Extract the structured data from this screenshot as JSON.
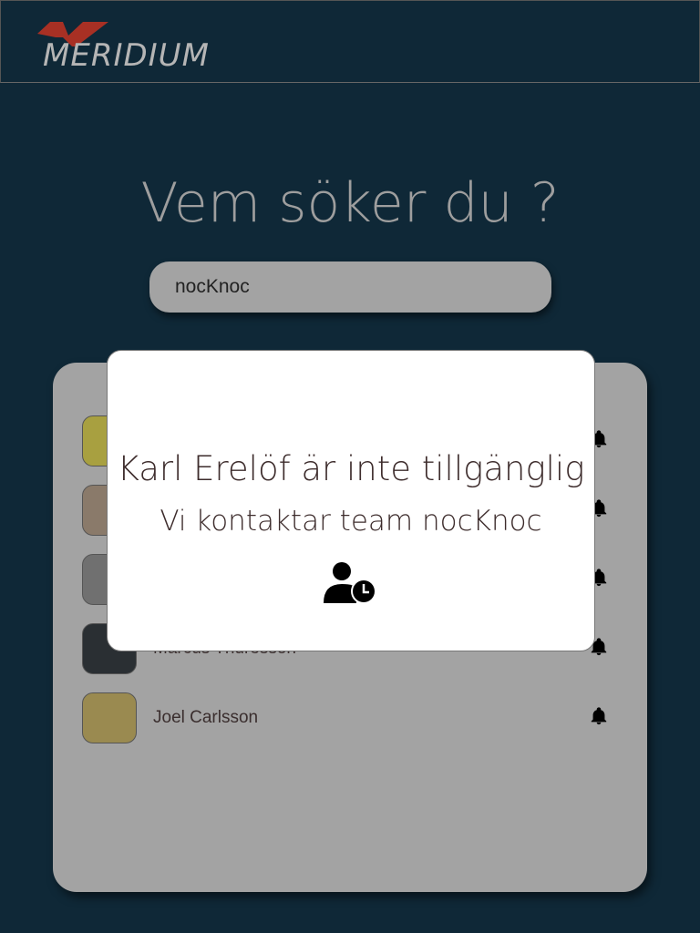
{
  "header": {
    "logo_text": "MERIDIUM",
    "brand_color": "#a83024"
  },
  "main": {
    "title": "Vem söker du ?",
    "search": {
      "value": "nocKnoc"
    },
    "contacts": [
      {
        "name": "",
        "avatar_color": "#a8a040"
      },
      {
        "name": "",
        "avatar_color": "#8a7a6a"
      },
      {
        "name": "",
        "avatar_color": "#707070"
      },
      {
        "name": "Marcus Thuresson",
        "avatar_color": "#2a2f33"
      },
      {
        "name": "Joel Carlsson",
        "avatar_color": "#9a8a50"
      }
    ]
  },
  "modal": {
    "title": "Karl Erelöf är inte tillgänglig",
    "message": "Vi kontaktar team nocKnoc",
    "icon": "user-clock-icon"
  }
}
